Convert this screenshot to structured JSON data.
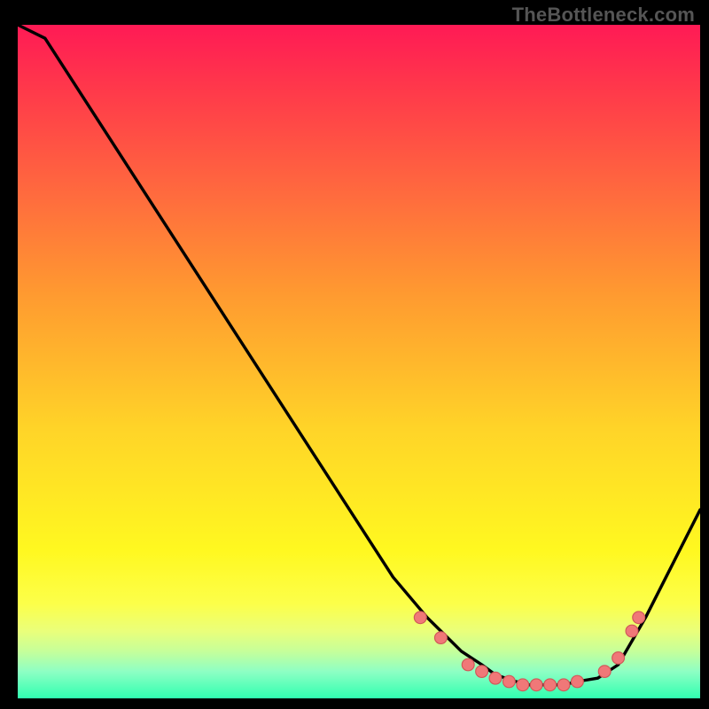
{
  "watermark": "TheBottleneck.com",
  "chart_data": {
    "type": "line",
    "title": "",
    "xlabel": "",
    "ylabel": "",
    "xlim": [
      0,
      100
    ],
    "ylim": [
      0,
      100
    ],
    "series": [
      {
        "name": "curve",
        "x": [
          0,
          4,
          55,
          60,
          62,
          65,
          68,
          70,
          73,
          75,
          78,
          80,
          82,
          85,
          88,
          92,
          95,
          100
        ],
        "values": [
          100,
          98,
          18,
          12,
          10,
          7,
          5,
          3.5,
          2.5,
          2,
          2,
          2,
          2.5,
          3,
          5,
          12,
          18,
          28
        ]
      }
    ],
    "points": {
      "name": "markers",
      "x": [
        59,
        62,
        66,
        68,
        70,
        72,
        74,
        76,
        78,
        80,
        82,
        86,
        88,
        90,
        91
      ],
      "values": [
        12,
        9,
        5,
        4,
        3,
        2.5,
        2,
        2,
        2,
        2,
        2.5,
        4,
        6,
        10,
        12
      ]
    },
    "gradient_stops": [
      {
        "pos": 0,
        "c": "#ff1a55"
      },
      {
        "pos": 10,
        "c": "#ff3a4a"
      },
      {
        "pos": 25,
        "c": "#ff6a3e"
      },
      {
        "pos": 40,
        "c": "#ff9a30"
      },
      {
        "pos": 60,
        "c": "#ffd428"
      },
      {
        "pos": 78,
        "c": "#fff820"
      },
      {
        "pos": 86,
        "c": "#fcff4a"
      },
      {
        "pos": 90,
        "c": "#eaff7a"
      },
      {
        "pos": 93,
        "c": "#c6ff9a"
      },
      {
        "pos": 96,
        "c": "#8effc4"
      },
      {
        "pos": 100,
        "c": "#30ffb0"
      }
    ],
    "colors": {
      "curve": "#000000",
      "marker_fill": "#f07878",
      "marker_stroke": "#d05858"
    }
  }
}
